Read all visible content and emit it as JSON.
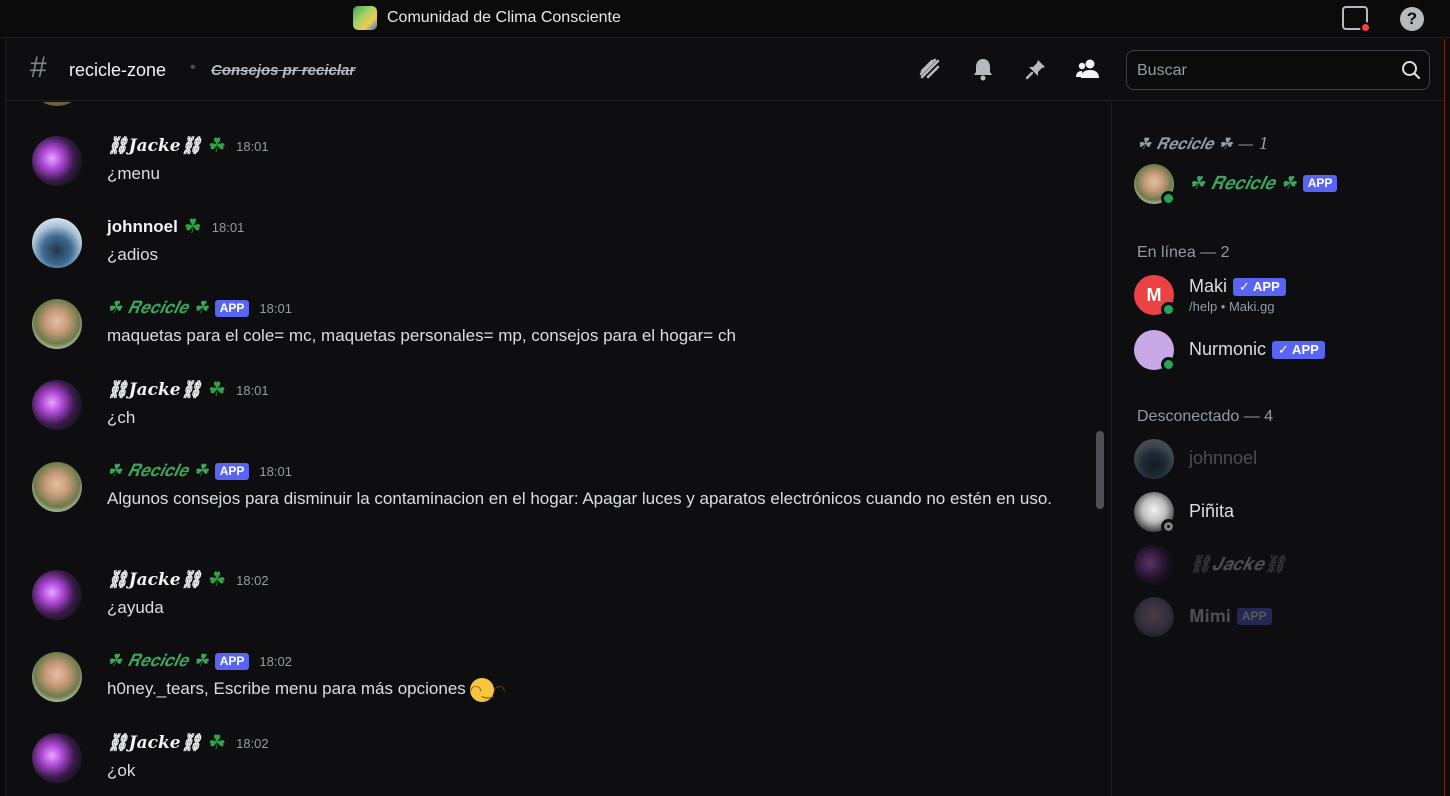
{
  "titlebar": {
    "server_name": "Comunidad de Clima Consciente"
  },
  "header": {
    "channel_name": "recicle-zone",
    "topic": "Consejos pr reciclar",
    "search_placeholder": "Buscar"
  },
  "messages": [
    {
      "author": "⛓𝑱𝒂𝒄𝒌𝒆⛓",
      "clover": "☘",
      "app": "",
      "time": "18:01",
      "text": "¿menu"
    },
    {
      "author": "johnnoel",
      "clover": "☘",
      "app": "",
      "time": "18:01",
      "text": "¿adios"
    },
    {
      "author": "☘ 𝑹𝒆𝒄𝒊𝒄𝒍𝒆 ☘",
      "clover": "",
      "app": "APP",
      "time": "18:01",
      "text": "maquetas para el cole= mc, maquetas personales= mp, consejos para el hogar= ch"
    },
    {
      "author": "⛓𝑱𝒂𝒄𝒌𝒆⛓",
      "clover": "☘",
      "app": "",
      "time": "18:01",
      "text": "¿ch"
    },
    {
      "author": "☘ 𝑹𝒆𝒄𝒊𝒄𝒍𝒆 ☘",
      "clover": "",
      "app": "APP",
      "time": "18:01",
      "text": "Algunos consejos para disminuir la contaminacion en el hogar: Apagar luces y aparatos electrónicos cuando no estén en uso."
    },
    {
      "author": "⛓𝑱𝒂𝒄𝒌𝒆⛓",
      "clover": "☘",
      "app": "",
      "time": "18:02",
      "text": "¿ayuda"
    },
    {
      "author": "☘ 𝑹𝒆𝒄𝒊𝒄𝒍𝒆 ☘",
      "clover": "",
      "app": "APP",
      "time": "18:02",
      "text": "h0ney._tears, Escribe menu para más opciones"
    },
    {
      "author": "⛓𝑱𝒂𝒄𝒌𝒆⛓",
      "clover": "☘",
      "app": "",
      "time": "18:02",
      "text": "¿ok"
    }
  ],
  "members": {
    "role_section": "☘ 𝑹𝒆𝒄𝒊𝒄𝒍𝒆 ☘ — 1",
    "online_section": "En línea — 2",
    "offline_section": "Desconectado — 4",
    "role_members": [
      {
        "name": "☘ 𝑹𝒆𝒄𝒊𝒄𝒍𝒆 ☘",
        "tag": "APP"
      }
    ],
    "online": [
      {
        "name": "Maki",
        "tag": "✓ APP",
        "sub": "/help • Maki.gg"
      },
      {
        "name": "Nurmonic",
        "tag": "✓ APP"
      }
    ],
    "offline": [
      {
        "name": "johnnoel"
      },
      {
        "name": "Piñita"
      },
      {
        "name": "⛓𝑱𝒂𝒄𝒌𝒆⛓"
      },
      {
        "name": "𝐌𝐢𝐦𝐢",
        "tag": "APP"
      }
    ]
  }
}
